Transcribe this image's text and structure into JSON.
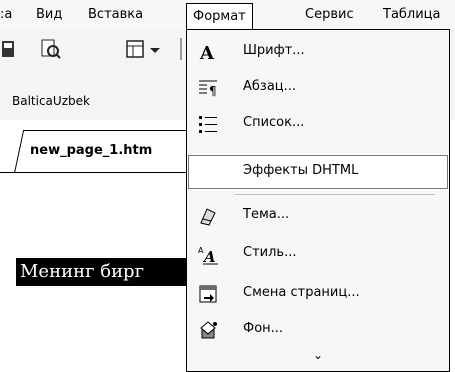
{
  "menubar": {
    "items": [
      {
        "label": ":а"
      },
      {
        "label": "Вид"
      },
      {
        "label": "Вставка"
      },
      {
        "label": "Формат"
      },
      {
        "label": "Сервис"
      },
      {
        "label": "Таблица"
      }
    ],
    "active": "Формат"
  },
  "toolbar": {
    "icons": [
      "save-icon",
      "preview-icon",
      "layout-icon",
      "dropdown-arrow-icon"
    ]
  },
  "formatbar": {
    "font_name": "BalticaUzbek"
  },
  "tabs": {
    "active_label": "new_page_1.htm"
  },
  "document": {
    "selected_text": "Менинг бирг"
  },
  "format_menu": {
    "items": [
      {
        "label": "Шрифт...",
        "icon": "font-A-icon"
      },
      {
        "label": "Абзац...",
        "icon": "paragraph-icon"
      },
      {
        "label": "Список...",
        "icon": "list-icon"
      },
      {
        "label": "Эффекты DHTML",
        "icon": ""
      },
      {
        "label": "Тема...",
        "icon": "theme-icon"
      },
      {
        "label": "Стиль...",
        "icon": "style-icon"
      },
      {
        "label": "Смена страниц...",
        "icon": "page-transition-icon"
      },
      {
        "label": "Фон...",
        "icon": "background-icon"
      }
    ],
    "more_glyph": "⌄"
  }
}
